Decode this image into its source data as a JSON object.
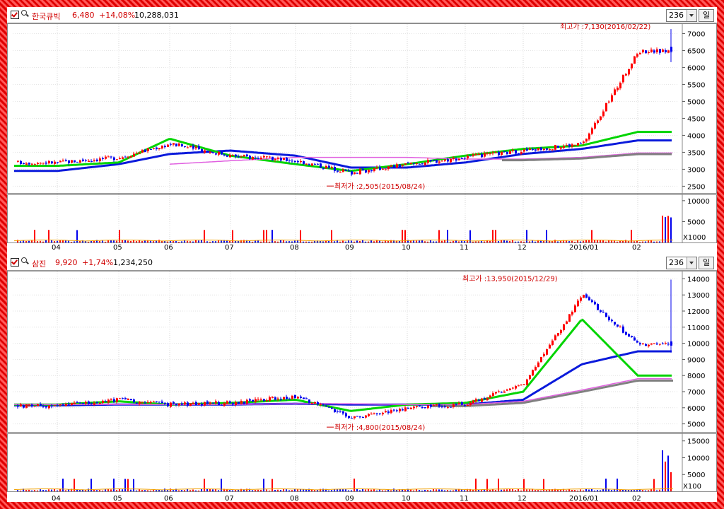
{
  "window": {
    "border_color": "#e00000"
  },
  "panes": [
    {
      "id": "top",
      "stock_name": "한국큐빅",
      "price": "6,480",
      "change": "+14,08%",
      "volume": "10,288,031",
      "count": "236",
      "period": "일",
      "high_note": "최고가 :7,130(2016/02/22)",
      "low_note": "최저가 :2,505(2015/08/24)",
      "price_ticks": [
        "7000",
        "6500",
        "6000",
        "5500",
        "5000",
        "4500",
        "4000",
        "3500",
        "3000",
        "2500"
      ],
      "vol_ticks": [
        "10000",
        "5000"
      ],
      "vol_unit": "X1000"
    },
    {
      "id": "bottom",
      "stock_name": "삼진",
      "price": "9,920",
      "change": "+1,74%",
      "volume": "1,234,250",
      "count": "236",
      "period": "일",
      "high_note": "최고가 :13,950(2015/12/29)",
      "low_note": "최저가 :4,800(2015/08/24)",
      "price_ticks": [
        "14000",
        "13000",
        "12000",
        "11000",
        "10000",
        "9000",
        "8000",
        "7000",
        "6000",
        "5000"
      ],
      "vol_ticks": [
        "15000",
        "10000",
        "5000"
      ],
      "vol_unit": "X100"
    }
  ],
  "x_labels": [
    "04",
    "05",
    "06",
    "07",
    "08",
    "09",
    "10",
    "11",
    "12",
    "2016/01",
    "02"
  ],
  "chart_data": [
    {
      "type": "candlestick",
      "title": "한국큐빅",
      "x": [
        "04",
        "05",
        "06",
        "07",
        "08",
        "09",
        "10",
        "11",
        "12",
        "2016/01",
        "02"
      ],
      "y_range": [
        2300,
        7300
      ],
      "series": [
        {
          "name": "close",
          "values": [
            3200,
            3350,
            3750,
            3400,
            3250,
            2900,
            3150,
            3350,
            3550,
            3750,
            6480
          ]
        },
        {
          "name": "ma_long",
          "values": [
            2950,
            3150,
            3450,
            3550,
            3400,
            3050,
            3050,
            3200,
            3450,
            3600,
            3850
          ]
        },
        {
          "name": "ma_mid",
          "values": [
            3100,
            3200,
            3900,
            3400,
            3150,
            2950,
            3150,
            3400,
            3600,
            3700,
            4100
          ]
        },
        {
          "name": "ma_slow",
          "values": [
            null,
            null,
            3150,
            3250,
            3350,
            3350,
            3350,
            3300,
            3300,
            3350,
            3480
          ]
        }
      ],
      "annotations": {
        "high": 7130,
        "low": 2505
      }
    },
    {
      "type": "candlestick",
      "title": "삼진",
      "x": [
        "04",
        "05",
        "06",
        "07",
        "08",
        "09",
        "10",
        "11",
        "12",
        "2016/01",
        "02"
      ],
      "y_range": [
        4500,
        14500
      ],
      "series": [
        {
          "name": "close",
          "values": [
            6100,
            6500,
            6200,
            6300,
            6700,
            5400,
            6000,
            6200,
            7500,
            13000,
            9920
          ]
        },
        {
          "name": "ma_long",
          "values": [
            6150,
            6200,
            6200,
            6200,
            6250,
            6200,
            6200,
            6200,
            6500,
            8700,
            9500
          ]
        },
        {
          "name": "ma_mid",
          "values": [
            6200,
            6400,
            6200,
            6300,
            6500,
            5800,
            6200,
            6300,
            7000,
            11500,
            8000
          ]
        },
        {
          "name": "ma_slow",
          "values": [
            null,
            null,
            null,
            6200,
            6250,
            6250,
            6200,
            6200,
            6400,
            7100,
            7800
          ]
        }
      ],
      "annotations": {
        "high": 13950,
        "low": 4800
      }
    }
  ]
}
